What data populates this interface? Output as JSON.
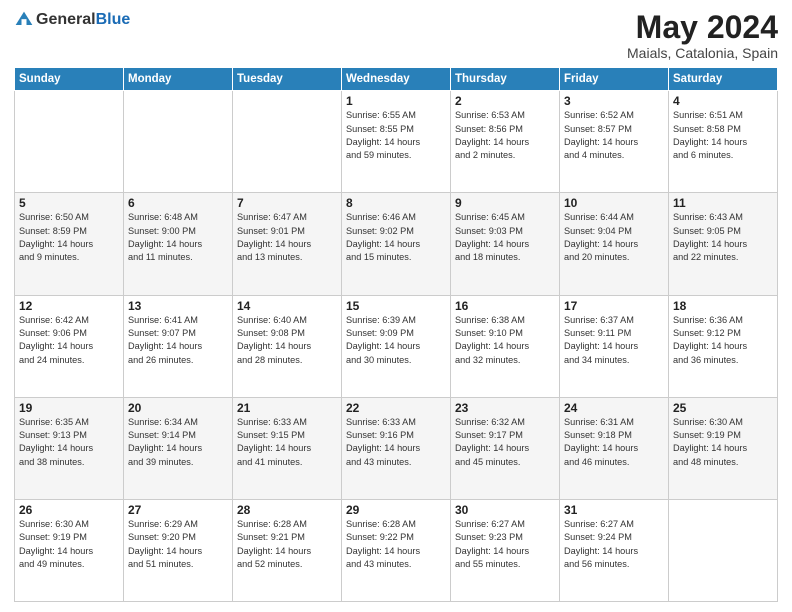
{
  "logo": {
    "general": "General",
    "blue": "Blue"
  },
  "title": "May 2024",
  "location": "Maials, Catalonia, Spain",
  "days_header": [
    "Sunday",
    "Monday",
    "Tuesday",
    "Wednesday",
    "Thursday",
    "Friday",
    "Saturday"
  ],
  "weeks": [
    [
      {
        "num": "",
        "info": ""
      },
      {
        "num": "",
        "info": ""
      },
      {
        "num": "",
        "info": ""
      },
      {
        "num": "1",
        "info": "Sunrise: 6:55 AM\nSunset: 8:55 PM\nDaylight: 14 hours\nand 59 minutes."
      },
      {
        "num": "2",
        "info": "Sunrise: 6:53 AM\nSunset: 8:56 PM\nDaylight: 14 hours\nand 2 minutes."
      },
      {
        "num": "3",
        "info": "Sunrise: 6:52 AM\nSunset: 8:57 PM\nDaylight: 14 hours\nand 4 minutes."
      },
      {
        "num": "4",
        "info": "Sunrise: 6:51 AM\nSunset: 8:58 PM\nDaylight: 14 hours\nand 6 minutes."
      }
    ],
    [
      {
        "num": "5",
        "info": "Sunrise: 6:50 AM\nSunset: 8:59 PM\nDaylight: 14 hours\nand 9 minutes."
      },
      {
        "num": "6",
        "info": "Sunrise: 6:48 AM\nSunset: 9:00 PM\nDaylight: 14 hours\nand 11 minutes."
      },
      {
        "num": "7",
        "info": "Sunrise: 6:47 AM\nSunset: 9:01 PM\nDaylight: 14 hours\nand 13 minutes."
      },
      {
        "num": "8",
        "info": "Sunrise: 6:46 AM\nSunset: 9:02 PM\nDaylight: 14 hours\nand 15 minutes."
      },
      {
        "num": "9",
        "info": "Sunrise: 6:45 AM\nSunset: 9:03 PM\nDaylight: 14 hours\nand 18 minutes."
      },
      {
        "num": "10",
        "info": "Sunrise: 6:44 AM\nSunset: 9:04 PM\nDaylight: 14 hours\nand 20 minutes."
      },
      {
        "num": "11",
        "info": "Sunrise: 6:43 AM\nSunset: 9:05 PM\nDaylight: 14 hours\nand 22 minutes."
      }
    ],
    [
      {
        "num": "12",
        "info": "Sunrise: 6:42 AM\nSunset: 9:06 PM\nDaylight: 14 hours\nand 24 minutes."
      },
      {
        "num": "13",
        "info": "Sunrise: 6:41 AM\nSunset: 9:07 PM\nDaylight: 14 hours\nand 26 minutes."
      },
      {
        "num": "14",
        "info": "Sunrise: 6:40 AM\nSunset: 9:08 PM\nDaylight: 14 hours\nand 28 minutes."
      },
      {
        "num": "15",
        "info": "Sunrise: 6:39 AM\nSunset: 9:09 PM\nDaylight: 14 hours\nand 30 minutes."
      },
      {
        "num": "16",
        "info": "Sunrise: 6:38 AM\nSunset: 9:10 PM\nDaylight: 14 hours\nand 32 minutes."
      },
      {
        "num": "17",
        "info": "Sunrise: 6:37 AM\nSunset: 9:11 PM\nDaylight: 14 hours\nand 34 minutes."
      },
      {
        "num": "18",
        "info": "Sunrise: 6:36 AM\nSunset: 9:12 PM\nDaylight: 14 hours\nand 36 minutes."
      }
    ],
    [
      {
        "num": "19",
        "info": "Sunrise: 6:35 AM\nSunset: 9:13 PM\nDaylight: 14 hours\nand 38 minutes."
      },
      {
        "num": "20",
        "info": "Sunrise: 6:34 AM\nSunset: 9:14 PM\nDaylight: 14 hours\nand 39 minutes."
      },
      {
        "num": "21",
        "info": "Sunrise: 6:33 AM\nSunset: 9:15 PM\nDaylight: 14 hours\nand 41 minutes."
      },
      {
        "num": "22",
        "info": "Sunrise: 6:33 AM\nSunset: 9:16 PM\nDaylight: 14 hours\nand 43 minutes."
      },
      {
        "num": "23",
        "info": "Sunrise: 6:32 AM\nSunset: 9:17 PM\nDaylight: 14 hours\nand 45 minutes."
      },
      {
        "num": "24",
        "info": "Sunrise: 6:31 AM\nSunset: 9:18 PM\nDaylight: 14 hours\nand 46 minutes."
      },
      {
        "num": "25",
        "info": "Sunrise: 6:30 AM\nSunset: 9:19 PM\nDaylight: 14 hours\nand 48 minutes."
      }
    ],
    [
      {
        "num": "26",
        "info": "Sunrise: 6:30 AM\nSunset: 9:19 PM\nDaylight: 14 hours\nand 49 minutes."
      },
      {
        "num": "27",
        "info": "Sunrise: 6:29 AM\nSunset: 9:20 PM\nDaylight: 14 hours\nand 51 minutes."
      },
      {
        "num": "28",
        "info": "Sunrise: 6:28 AM\nSunset: 9:21 PM\nDaylight: 14 hours\nand 52 minutes."
      },
      {
        "num": "29",
        "info": "Sunrise: 6:28 AM\nSunset: 9:22 PM\nDaylight: 14 hours\nand 43 minutes."
      },
      {
        "num": "30",
        "info": "Sunrise: 6:27 AM\nSunset: 9:23 PM\nDaylight: 14 hours\nand 55 minutes."
      },
      {
        "num": "31",
        "info": "Sunrise: 6:27 AM\nSunset: 9:24 PM\nDaylight: 14 hours\nand 56 minutes."
      },
      {
        "num": "",
        "info": ""
      }
    ]
  ]
}
